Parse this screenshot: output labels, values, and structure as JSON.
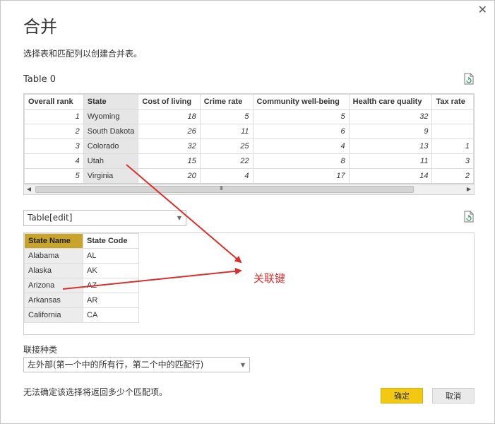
{
  "dialog": {
    "title": "合并",
    "subtitle": "选择表和匹配列以创建合并表。",
    "close_glyph": "✕"
  },
  "table1": {
    "label": "Table 0",
    "columns": [
      "Overall rank",
      "State",
      "Cost of living",
      "Crime rate",
      "Community well-being",
      "Health care quality",
      "Tax rate"
    ],
    "rows": [
      [
        "1",
        "Wyoming",
        "18",
        "5",
        "5",
        "32",
        ""
      ],
      [
        "2",
        "South Dakota",
        "26",
        "11",
        "6",
        "9",
        ""
      ],
      [
        "3",
        "Colorado",
        "32",
        "25",
        "4",
        "13",
        "1"
      ],
      [
        "4",
        "Utah",
        "15",
        "22",
        "8",
        "11",
        "3"
      ],
      [
        "5",
        "Virginia",
        "20",
        "4",
        "17",
        "14",
        "2"
      ]
    ],
    "scroll_grip": "III"
  },
  "table2": {
    "selected": "Table[edit]",
    "columns": [
      "State Name",
      "State Code"
    ],
    "rows": [
      [
        "Alabama",
        "AL"
      ],
      [
        "Alaska",
        "AK"
      ],
      [
        "Arizona",
        "AZ"
      ],
      [
        "Arkansas",
        "AR"
      ],
      [
        "California",
        "CA"
      ]
    ]
  },
  "join": {
    "label": "联接种类",
    "selected": "左外部(第一个中的所有行，第二个中的匹配行)"
  },
  "footer": {
    "message": "无法确定该选择将返回多少个匹配项。",
    "ok_label": "确定",
    "cancel_label": "取消"
  },
  "annotation": {
    "text": "关联键",
    "color": "#d9302c"
  },
  "colors": {
    "accent": "#f2c811",
    "selected_header": "#c8a52a"
  },
  "icons": [
    "close-icon",
    "refresh-icon",
    "chevron-down-icon",
    "arrow-left-icon",
    "arrow-right-icon"
  ]
}
